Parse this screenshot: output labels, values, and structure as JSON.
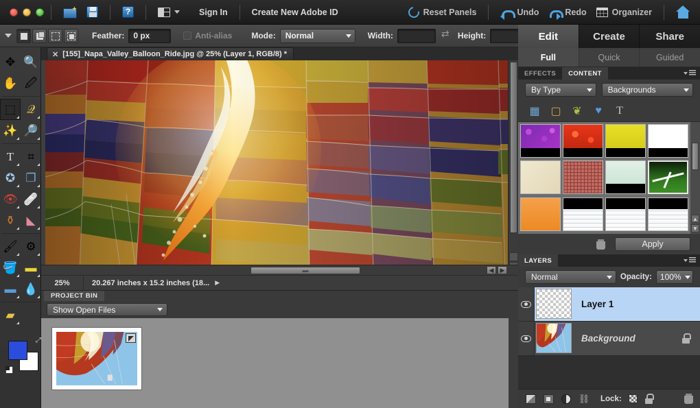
{
  "titlebar": {
    "signin": "Sign In",
    "create_id": "Create New Adobe ID",
    "help_glyph": "?",
    "reset_panels": "Reset Panels",
    "undo": "Undo",
    "redo": "Redo",
    "organizer": "Organizer"
  },
  "options_bar": {
    "feather_label": "Feather:",
    "feather_value": "0 px",
    "antialias_label": "Anti-alias",
    "mode_label": "Mode:",
    "mode_value": "Normal",
    "width_label": "Width:",
    "width_value": "",
    "height_label": "Height:",
    "height_value": ""
  },
  "toolbar": {
    "tools": [
      {
        "name": "move-tool",
        "glyph": "✥"
      },
      {
        "name": "zoom-tool",
        "glyph": "🔍"
      },
      {
        "name": "hand-tool",
        "glyph": "✋"
      },
      {
        "name": "eyedropper-tool",
        "glyph": "💉"
      },
      {
        "name": "rectangular-marquee-tool",
        "glyph": "⬚"
      },
      {
        "name": "lasso-tool",
        "glyph": "🪢"
      },
      {
        "name": "magic-wand-tool",
        "glyph": "✨"
      },
      {
        "name": "quick-selection-tool",
        "glyph": "🔎"
      },
      {
        "name": "type-tool",
        "glyph": "T"
      },
      {
        "name": "crop-tool",
        "glyph": "⌗"
      },
      {
        "name": "cookie-cutter-tool",
        "glyph": "✪"
      },
      {
        "name": "straighten-tool",
        "glyph": "▤"
      },
      {
        "name": "red-eye-removal-tool",
        "glyph": "👁"
      },
      {
        "name": "healing-brush-tool",
        "glyph": "🩹"
      },
      {
        "name": "clone-stamp-tool",
        "glyph": "⚗"
      },
      {
        "name": "eraser-tool",
        "glyph": "◣"
      },
      {
        "name": "brush-tool",
        "glyph": "🖌"
      },
      {
        "name": "smart-brush-tool",
        "glyph": "⚙"
      },
      {
        "name": "paint-bucket-tool",
        "glyph": "🪣"
      },
      {
        "name": "gradient-tool",
        "glyph": "▭"
      },
      {
        "name": "shape-tool",
        "glyph": "▬"
      },
      {
        "name": "blur-tool",
        "glyph": "💧"
      },
      {
        "name": "sponge-tool",
        "glyph": "🧽"
      }
    ],
    "foreground_color": "#2b4ddd",
    "background_color": "#ffffff"
  },
  "document": {
    "tab_title": "[155]_Napa_Valley_Balloon_Ride.jpg @ 25% (Layer 1, RGB/8) *",
    "close_glyph": "✕",
    "zoom": "25%",
    "dimensions": "20.267 inches x 15.2 inches (18...",
    "dim_arrow": "▶"
  },
  "project_bin": {
    "title": "PROJECT BIN",
    "filter_value": "Show Open Files"
  },
  "right_panel": {
    "main_tabs": [
      {
        "label": "Edit",
        "active": true
      },
      {
        "label": "Create",
        "active": false
      },
      {
        "label": "Share",
        "active": false
      }
    ],
    "sub_tabs": [
      {
        "label": "Full",
        "active": true
      },
      {
        "label": "Quick",
        "active": false
      },
      {
        "label": "Guided",
        "active": false
      }
    ],
    "content_panel": {
      "tabs": [
        {
          "label": "EFFECTS",
          "active": false
        },
        {
          "label": "CONTENT",
          "active": true
        }
      ],
      "filter_by": "By Type",
      "filter_type": "Backgrounds",
      "category_icons": [
        {
          "name": "frames-icon",
          "glyph": "▦"
        },
        {
          "name": "backgrounds-icon",
          "glyph": "▢"
        },
        {
          "name": "graphics-icon",
          "glyph": "❦"
        },
        {
          "name": "shapes-icon",
          "glyph": "♥"
        },
        {
          "name": "text-icon",
          "glyph": "T"
        }
      ],
      "thumbnails": [
        {
          "name": "background-purple-bokeh",
          "color": "#8a2fb8",
          "selected": false
        },
        {
          "name": "background-red-texture",
          "color": "#e2341c",
          "selected": false
        },
        {
          "name": "background-yellow",
          "color": "#e3dc24",
          "selected": false
        },
        {
          "name": "background-white",
          "color": "#ffffff",
          "selected": false
        },
        {
          "name": "background-cream",
          "color": "#ece3c8",
          "selected": false
        },
        {
          "name": "background-red-weave",
          "color": "#c06c62",
          "selected": false
        },
        {
          "name": "background-mint",
          "color": "#d4e8dc",
          "selected": false
        },
        {
          "name": "background-grass-field",
          "color": "#3c7a22",
          "selected": true
        },
        {
          "name": "background-orange",
          "color": "#f09231",
          "selected": false
        },
        {
          "name": "background-notebook-1",
          "color": "#f7f7f7",
          "selected": false
        },
        {
          "name": "background-notebook-2",
          "color": "#f7f7f7",
          "selected": false
        },
        {
          "name": "background-notebook-3",
          "color": "#f7f7f7",
          "selected": false
        }
      ],
      "apply_label": "Apply"
    },
    "layers_panel": {
      "title": "LAYERS",
      "blend_mode": "Normal",
      "opacity_label": "Opacity:",
      "opacity_value": "100%",
      "layers": [
        {
          "name": "Layer 1",
          "selected": true,
          "visible": true,
          "locked": false,
          "thumb": "checker"
        },
        {
          "name": "Background",
          "selected": false,
          "visible": true,
          "locked": true,
          "thumb": "balloon"
        }
      ],
      "footer": {
        "lock_label": "Lock:",
        "icons": [
          {
            "name": "new-layer-icon"
          },
          {
            "name": "add-layer-mask-icon"
          },
          {
            "name": "adjustment-layer-icon"
          },
          {
            "name": "link-layers-icon"
          },
          {
            "name": "lock-transparency-icon"
          },
          {
            "name": "lock-all-icon"
          },
          {
            "name": "delete-layer-icon"
          }
        ]
      }
    }
  },
  "colors": {
    "accent_blue": "#4ea3e0",
    "selection_blue": "#b9d5f5",
    "panel_bg": "#3a3a3a",
    "title_bg": "#222222"
  }
}
